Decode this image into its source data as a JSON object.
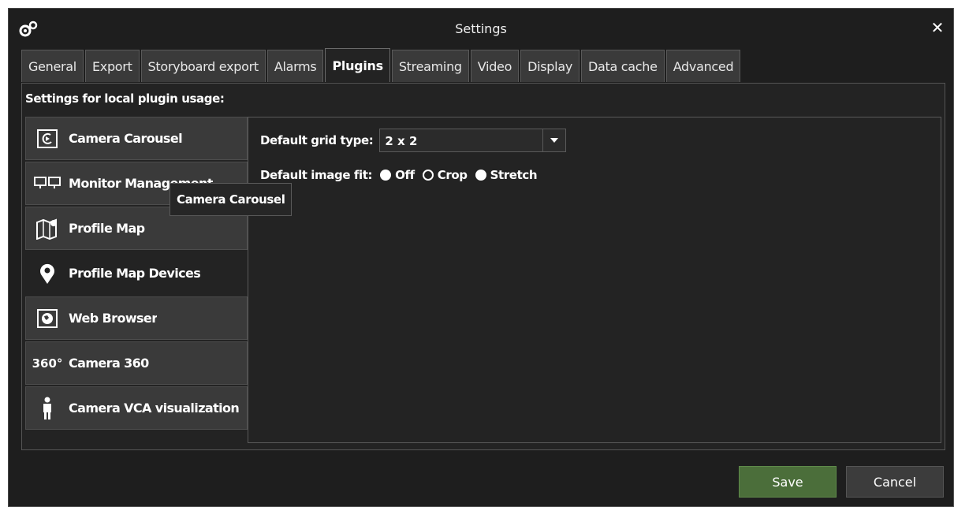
{
  "window": {
    "title": "Settings",
    "close_glyph": "✕",
    "title_icon": "gear-icon"
  },
  "tabs": [
    {
      "label": "General",
      "active": false
    },
    {
      "label": "Export",
      "active": false
    },
    {
      "label": "Storyboard export",
      "active": false
    },
    {
      "label": "Alarms",
      "active": false
    },
    {
      "label": "Plugins",
      "active": true
    },
    {
      "label": "Streaming",
      "active": false
    },
    {
      "label": "Video",
      "active": false
    },
    {
      "label": "Display",
      "active": false
    },
    {
      "label": "Data cache",
      "active": false
    },
    {
      "label": "Advanced",
      "active": false
    }
  ],
  "plugins": {
    "section_label": "Settings for local plugin usage:",
    "items": [
      {
        "label": "Camera Carousel",
        "icon": "camera-carousel-icon"
      },
      {
        "label": "Monitor Management",
        "icon": "monitor-icon"
      },
      {
        "label": "Profile Map",
        "icon": "map-icon"
      },
      {
        "label": "Profile Map Devices",
        "icon": "map-pin-icon",
        "selected": true
      },
      {
        "label": "Web Browser",
        "icon": "globe-icon"
      },
      {
        "label": "Camera 360",
        "icon": "camera-360-icon",
        "icon_text": "360°"
      },
      {
        "label": "Camera VCA visualization",
        "icon": "person-icon"
      }
    ],
    "tooltip": "Camera Carousel"
  },
  "panel": {
    "grid_type_label": "Default grid type:",
    "grid_type_value": "2 x 2",
    "image_fit_label": "Default image fit:",
    "image_fit_options": [
      {
        "label": "Off",
        "selected": true
      },
      {
        "label": "Crop",
        "selected": false
      },
      {
        "label": "Stretch",
        "selected": true
      }
    ]
  },
  "footer": {
    "save_label": "Save",
    "cancel_label": "Cancel"
  },
  "colors": {
    "background": "#1e1e1e",
    "save": "#4b6e3a",
    "tab": "#3a3a3a"
  }
}
